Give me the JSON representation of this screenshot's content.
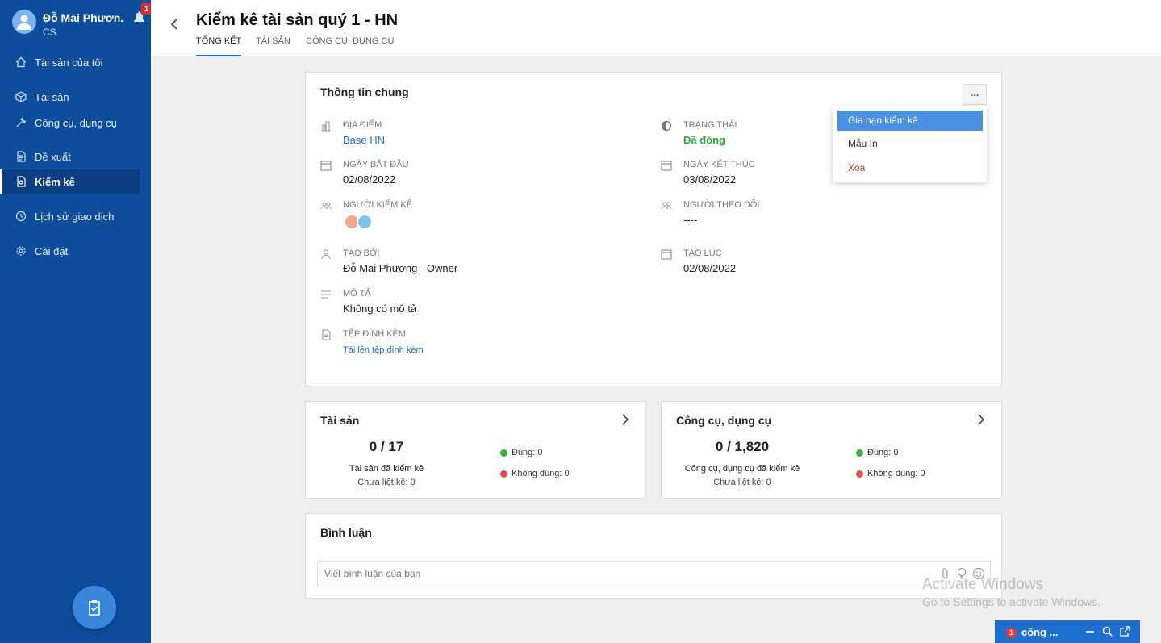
{
  "user": {
    "name": "Đỗ Mai Phươn...",
    "role": "CS",
    "notification_count": "1"
  },
  "sidebar": {
    "items": [
      {
        "label": "Tài sản của tôi",
        "icon": "home-icon"
      },
      {
        "label": "Tài sản",
        "icon": "box-icon"
      },
      {
        "label": "Công cụ, dụng cụ",
        "icon": "tools-icon"
      },
      {
        "label": "Đề xuất",
        "icon": "document-icon"
      },
      {
        "label": "Kiểm kê",
        "icon": "audit-icon",
        "active": true
      },
      {
        "label": "Lịch sử giao dịch",
        "icon": "history-icon"
      },
      {
        "label": "Cài đặt",
        "icon": "gear-icon"
      }
    ]
  },
  "header": {
    "title": "Kiểm kê tài sản quý 1 - HN",
    "tabs": [
      {
        "label": "TỔNG KẾT",
        "active": true
      },
      {
        "label": "TÀI SẢN"
      },
      {
        "label": "CÔNG CỤ, DỤNG CỤ"
      }
    ]
  },
  "general": {
    "title": "Thông tin chung",
    "more_label": "...",
    "location": {
      "label": "ĐỊA ĐIỂM",
      "value": "Base HN"
    },
    "status": {
      "label": "TRẠNG THÁI",
      "value": "Đã đóng"
    },
    "start_date": {
      "label": "NGÀY BẮT ĐẦU",
      "value": "02/08/2022"
    },
    "end_date": {
      "label": "NGÀY KẾT THÚC",
      "value": "03/08/2022"
    },
    "auditors": {
      "label": "NGƯỜI KIỂM KÊ"
    },
    "followers": {
      "label": "NGƯỜI THEO DÕI",
      "value": "----"
    },
    "created_by": {
      "label": "TẠO BỞI",
      "value": "Đỗ Mai Phương - Owner"
    },
    "created_at": {
      "label": "TẠO LÚC",
      "value": "02/08/2022"
    },
    "description": {
      "label": "MÔ TẢ",
      "value": "Không có mô tả"
    },
    "attachments": {
      "label": "TỆP ĐÍNH KÈM",
      "value": "Tải lên tệp đính kèm"
    }
  },
  "dropdown": {
    "items": [
      "Gia hạn kiểm kê",
      "Mẫu In",
      "Xóa"
    ]
  },
  "assets_card": {
    "title": "Tài sản",
    "count": "0 / 17",
    "subtitle": "Tài sản đã kiểm kê",
    "unlisted": "Chưa liệt kê: 0",
    "correct": "Đúng: 0",
    "incorrect": "Không đúng: 0"
  },
  "tools_card": {
    "title": "Công cụ, dụng cụ",
    "count": "0 / 1,820",
    "subtitle": "Công cụ, dụng cụ đã kiểm kê",
    "unlisted": "Chưa liệt kê: 0",
    "correct": "Đúng: 0",
    "incorrect": "Không đúng: 0"
  },
  "comments": {
    "title": "Bình luận",
    "placeholder": "Viết bình luận của bạn"
  },
  "watermark": {
    "line1": "Activate Windows",
    "line2": "Go to Settings to activate Windows."
  },
  "chat": {
    "badge": "1",
    "label": "công ..."
  },
  "colors": {
    "sidebar": "#0e4d9c",
    "accent": "#1f6fd1",
    "success": "#2eaa3c",
    "danger": "#c0392b"
  }
}
